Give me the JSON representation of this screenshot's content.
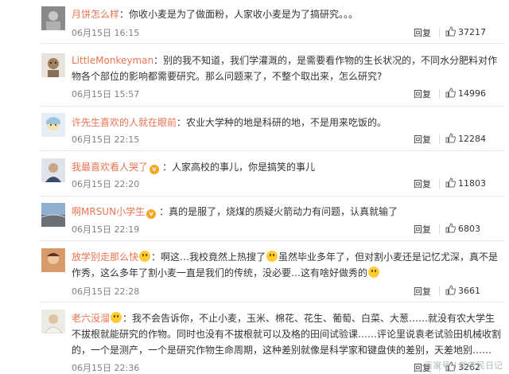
{
  "comments": [
    {
      "user": "月饼怎么样",
      "badge": "",
      "content": "：你收小麦是为了做面粉，人家收小麦是为了搞研究。。。",
      "content2": "",
      "time": "06月15日 16:15",
      "reply": "回复",
      "likes": "37217",
      "avatar_color": "#8a8a8a"
    },
    {
      "user": "LittleMonkeyman",
      "badge": "",
      "content": "：别的我不知道，我们学灌溉的，是需要看作物的生长状况的，不同水分肥料对作物各个部位的影响都需要研究。那么问题来了，不整个取出来，怎么研究?",
      "content2": "",
      "time": "06月15日 15:57",
      "reply": "回复",
      "likes": "14996",
      "avatar_color": "#b8b0a0"
    },
    {
      "user": "许先生喜欢的人就在眼前",
      "badge": "",
      "content": "：农业大学种的地是科研的地，不是用来吃饭的。",
      "content2": "",
      "time": "06月15日 22:15",
      "reply": "回复",
      "likes": "12284",
      "avatar_color": "#c9d8e8"
    },
    {
      "user": "我最喜欢看人哭了",
      "badge": "v",
      "content": "：人家高校的事儿，你是搞笑的事儿",
      "content2": "",
      "time": "06月15日 22:20",
      "reply": "回复",
      "likes": "11803",
      "avatar_color": "#d9dde6"
    },
    {
      "user": "啊MRSUN小学生",
      "badge": "v",
      "content": "：真的是服了，烧煤的质疑火箭动力有问题，认真就输了",
      "content2": "",
      "time": "06月15日 22:19",
      "reply": "回复",
      "likes": "6803",
      "avatar_color": "#9aa0a8"
    },
    {
      "user": "放学别走那么快",
      "badge": "v",
      "content": "：啊这…我校竟然上热搜了",
      "content_mid": "虽然毕业多年了，但对割小麦还是记忆尤深，真不是作秀，这么多年了割小麦一直是我们的传统，没必要…这有啥好做秀的",
      "content2": "",
      "time": "06月15日 22:28",
      "reply": "回复",
      "likes": "3661",
      "avatar_color": "#c07a4a"
    },
    {
      "user": "老六没溜",
      "badge": "v",
      "content": "：我不会告诉你，不止小麦，玉米、棉花、花生、葡萄、白菜、大葱……就没有农大学生不拔根就能研究的作物。同时也没有不拔根就可以及格的田间试验课……评论里说袁老试验田机械收割的，一个是测产，一个是研究作物生命周期，这种差别就像是科学家和键盘侠的差别，天差地别……",
      "content2": "",
      "time": "06月15日 22:36",
      "reply": "回复",
      "likes": "3262",
      "avatar_color": "#d0c8c0"
    }
  ],
  "watermark": "百家号 / 新农民日记"
}
